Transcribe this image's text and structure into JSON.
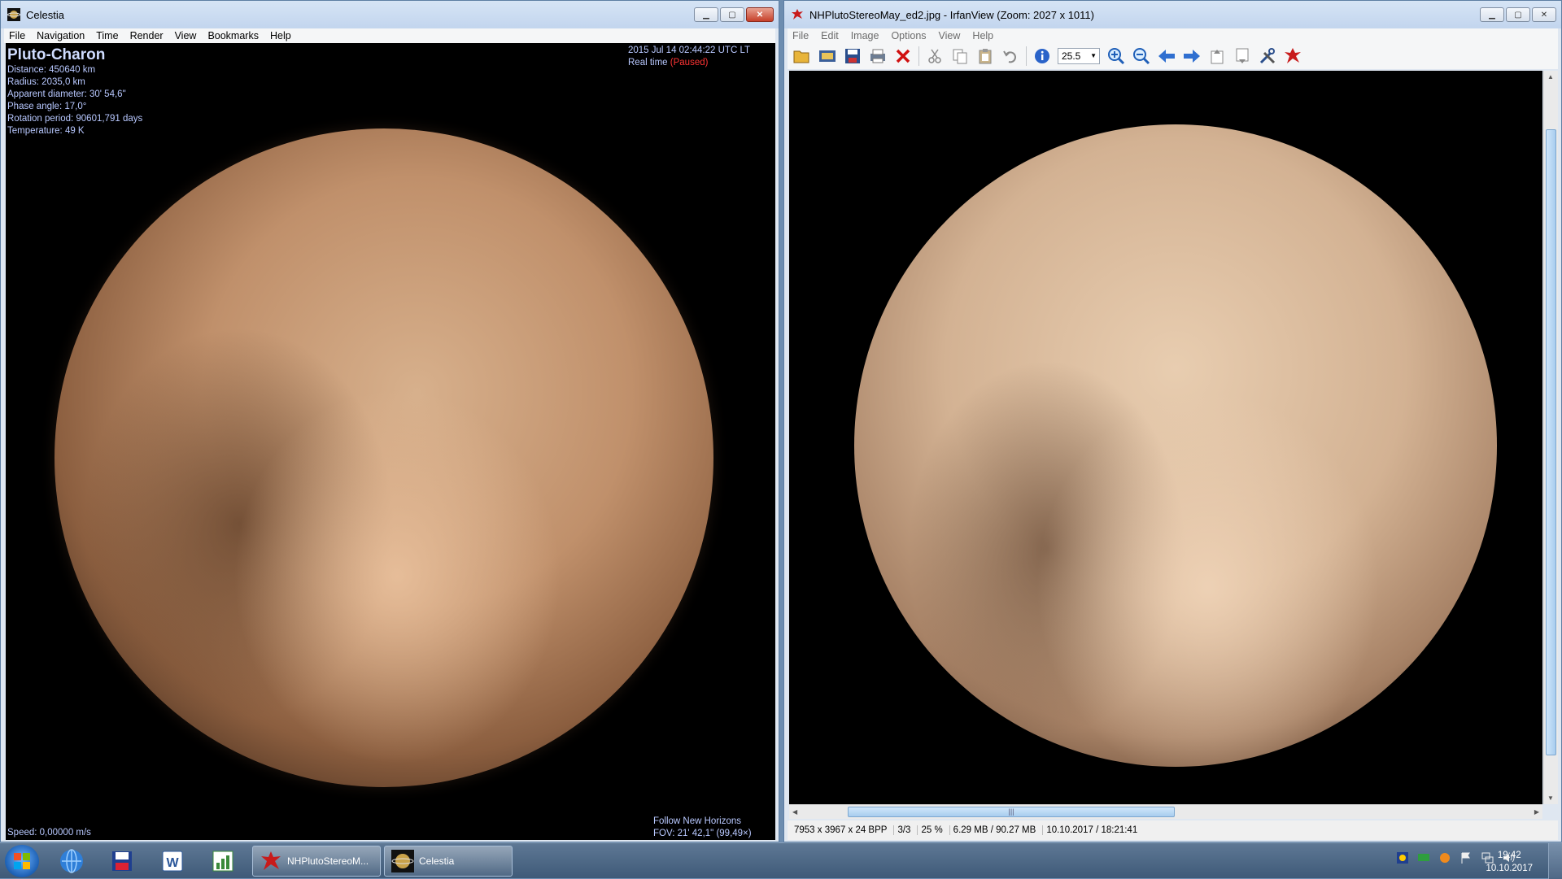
{
  "celestia": {
    "title": "Celestia",
    "menu": [
      "File",
      "Navigation",
      "Time",
      "Render",
      "View",
      "Bookmarks",
      "Help"
    ],
    "hud": {
      "object_name": "Pluto-Charon",
      "distance": "Distance: 450640 km",
      "radius": "Radius: 2035,0 km",
      "apparent_diameter": "Apparent diameter: 30' 54,6\"",
      "phase_angle": "Phase angle: 17,0°",
      "rotation_period": "Rotation period: 90601,791 days",
      "temperature": "Temperature: 49 K",
      "datetime": "2015 Jul 14 02:44:22 UTC  LT",
      "real_time": "Real time",
      "paused": "(Paused)",
      "speed": "Speed: 0,00000 m/s",
      "follow": "Follow New Horizons",
      "fov": "FOV: 21' 42,1\" (99,49×)"
    }
  },
  "irfanview": {
    "title": "NHPlutoStereoMay_ed2.jpg - IrfanView (Zoom: 2027 x 1011)",
    "menu": [
      "File",
      "Edit",
      "Image",
      "Options",
      "View",
      "Help"
    ],
    "zoom_value": "25.5",
    "status": {
      "dimensions": "7953 x 3967 x 24 BPP",
      "index": "3/3",
      "zoom_percent": "25 %",
      "memory": "6.29 MB / 90.27 MB",
      "date": "10.10.2017 / 18:21:41"
    }
  },
  "taskbar": {
    "tasks": [
      "NHPlutoStereoM...",
      "Celestia"
    ],
    "clock_time": "19:42",
    "clock_date": "10.10.2017"
  },
  "colors": {
    "hud_text": "#b8c8ff",
    "paused": "#ff3333",
    "taskbar": "#4a6584"
  }
}
